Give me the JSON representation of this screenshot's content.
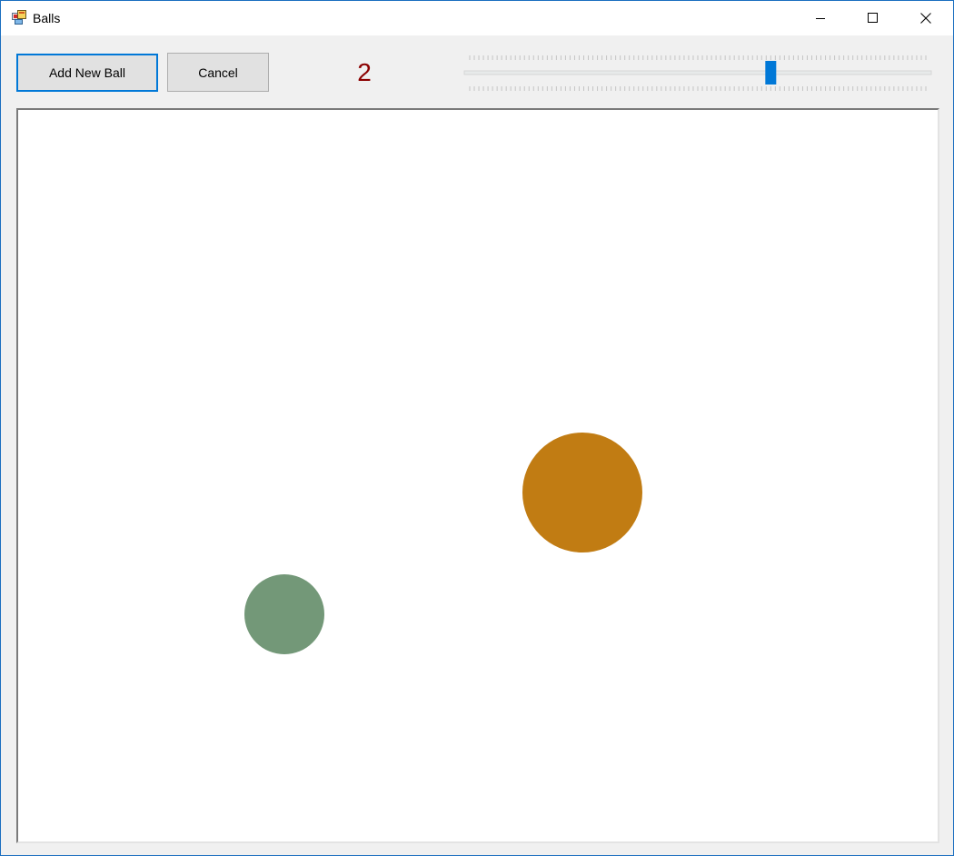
{
  "window": {
    "title": "Balls"
  },
  "icons": {
    "app": "app-window-icon",
    "minimize": "minimize-icon",
    "maximize": "maximize-icon",
    "close": "close-icon"
  },
  "toolbar": {
    "add_label": "Add New Ball",
    "cancel_label": "Cancel",
    "ball_count": "2",
    "slider_value_fraction": 0.66
  },
  "balls": [
    {
      "name": "orange-ball",
      "color": "#c17c13"
    },
    {
      "name": "green-ball",
      "color": "#739878"
    }
  ],
  "colors": {
    "accent": "#0078d7",
    "count_text": "#8b0000",
    "window_border": "#1b6fc0"
  }
}
